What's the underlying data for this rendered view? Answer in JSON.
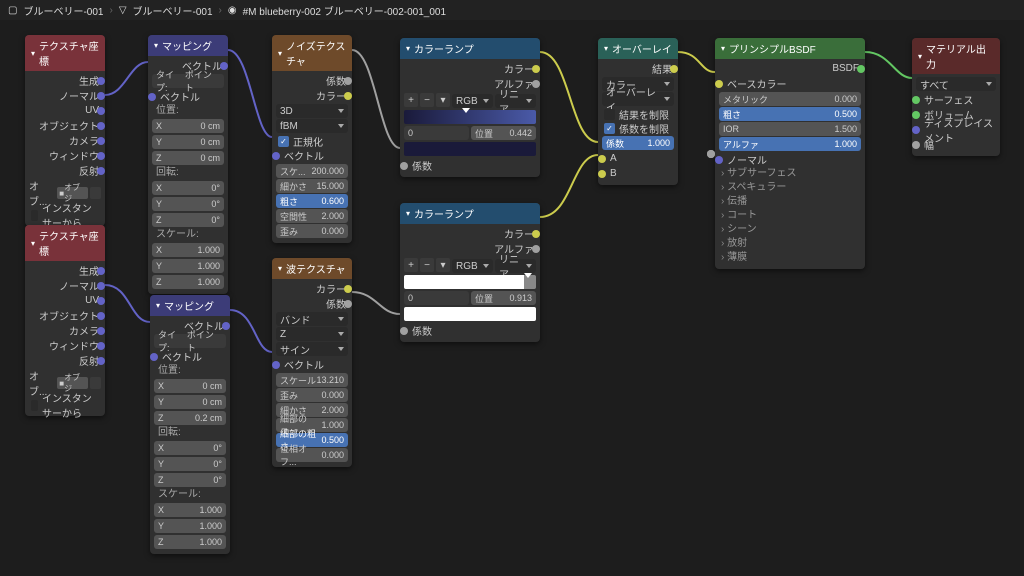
{
  "breadcrumb": [
    "ブルーベリー-001",
    "ブルーベリー-001",
    "#M blueberry-002 ブルーベリー-002-001_001"
  ],
  "nodes": {
    "texcoord1": {
      "title": "テクスチャ座標",
      "outputs": [
        "生成",
        "ノーマル",
        "UV",
        "オブジェクト",
        "カメラ",
        "ウィンドウ",
        "反射"
      ],
      "obj_label": "オブ...",
      "obj_value": "オブジ",
      "instancer": "インスタンサーから"
    },
    "texcoord2": {
      "title": "テクスチャ座標",
      "outputs": [
        "生成",
        "ノーマル",
        "UV",
        "オブジェクト",
        "カメラ",
        "ウィンドウ",
        "反射"
      ],
      "obj_label": "オブ...",
      "obj_value": "オブジ",
      "instancer": "インスタンサーから"
    },
    "mapping1": {
      "title": "マッピング",
      "out_vec": "ベクトル",
      "type_label": "タイプ:",
      "type_value": "ポイント",
      "in_vec": "ベクトル",
      "loc_label": "位置:",
      "loc": [
        [
          "X",
          "0 cm"
        ],
        [
          "Y",
          "0 cm"
        ],
        [
          "Z",
          "0 cm"
        ]
      ],
      "rot_label": "回転:",
      "rot": [
        [
          "X",
          "0°"
        ],
        [
          "Y",
          "0°"
        ],
        [
          "Z",
          "0°"
        ]
      ],
      "scale_label": "スケール:",
      "scale": [
        [
          "X",
          "1.000"
        ],
        [
          "Y",
          "1.000"
        ],
        [
          "Z",
          "1.000"
        ]
      ]
    },
    "mapping2": {
      "title": "マッピング",
      "out_vec": "ベクトル",
      "type_label": "タイプ:",
      "type_value": "ポイント",
      "in_vec": "ベクトル",
      "loc_label": "位置:",
      "loc": [
        [
          "X",
          "0 cm"
        ],
        [
          "Y",
          "0 cm"
        ],
        [
          "Z",
          "0.2 cm"
        ]
      ],
      "rot_label": "回転:",
      "rot": [
        [
          "X",
          "0°"
        ],
        [
          "Y",
          "0°"
        ],
        [
          "Z",
          "0°"
        ]
      ],
      "scale_label": "スケール:",
      "scale": [
        [
          "X",
          "1.000"
        ],
        [
          "Y",
          "1.000"
        ],
        [
          "Z",
          "1.000"
        ]
      ]
    },
    "noise": {
      "title": "ノイズテクスチャ",
      "out_fac": "係数",
      "out_color": "カラー",
      "dim": "3D",
      "type": "fBM",
      "normalize": "正規化",
      "in_vec": "ベクトル",
      "params": [
        [
          "スケ...",
          "200.000"
        ],
        [
          "細かさ",
          "15.000"
        ],
        [
          "粗さ",
          "0.600",
          "blue"
        ],
        [
          "空間性",
          "2.000"
        ],
        [
          "歪み",
          "0.000"
        ]
      ]
    },
    "ramp1": {
      "title": "カラーランプ",
      "out_color": "カラー",
      "out_alpha": "アルファ",
      "modeA": "RGB",
      "modeB": "リニア",
      "pos_n": "0",
      "pos_label": "位置",
      "pos_val": "0.442",
      "in_fac": "係数"
    },
    "ramp2": {
      "title": "カラーランプ",
      "out_color": "カラー",
      "out_alpha": "アルファ",
      "modeA": "RGB",
      "modeB": "リニア",
      "pos_n": "0",
      "pos_label": "位置",
      "pos_val": "0.913",
      "in_fac": "係数"
    },
    "wave": {
      "title": "波テクスチャ",
      "out_color": "カラー",
      "out_fac": "係数",
      "type": "バンド",
      "axis": "Z",
      "profile": "サイン",
      "in_vec": "ベクトル",
      "params": [
        [
          "スケール",
          "13.210"
        ],
        [
          "歪み",
          "0.000"
        ],
        [
          "細かさ",
          "2.000"
        ],
        [
          "細部のス...",
          "1.000"
        ],
        [
          "細部の粗さ",
          "0.500",
          "blue"
        ],
        [
          "位相オフ...",
          "0.000"
        ]
      ]
    },
    "overlay": {
      "title": "オーバーレイ",
      "out_result": "結果",
      "dd_color": "カラー",
      "dd_overlay": "オーバーレイ",
      "clamp_result": "結果を制限",
      "clamp_fac": "係数を制限",
      "fac_label": "係数",
      "fac_val": "1.000",
      "in_A": "A",
      "in_B": "B"
    },
    "bsdf": {
      "title": "プリンシプルBSDF",
      "out_bsdf": "BSDF",
      "base_color": "ベースカラー",
      "metallic": [
        "メタリック",
        "0.000"
      ],
      "roughness": [
        "粗さ",
        "0.500"
      ],
      "ior": [
        "IOR",
        "1.500"
      ],
      "alpha": [
        "アルファ",
        "1.000"
      ],
      "normal": "ノーマル",
      "expands": [
        "サブサーフェス",
        "スペキュラー",
        "伝播",
        "コート",
        "シーン",
        "放射",
        "薄膜"
      ]
    },
    "output": {
      "title": "マテリアル出力",
      "target": "すべて",
      "surface": "サーフェス",
      "volume": "ボリューム",
      "disp": "ディスプレイスメント",
      "thick": "幅"
    }
  }
}
